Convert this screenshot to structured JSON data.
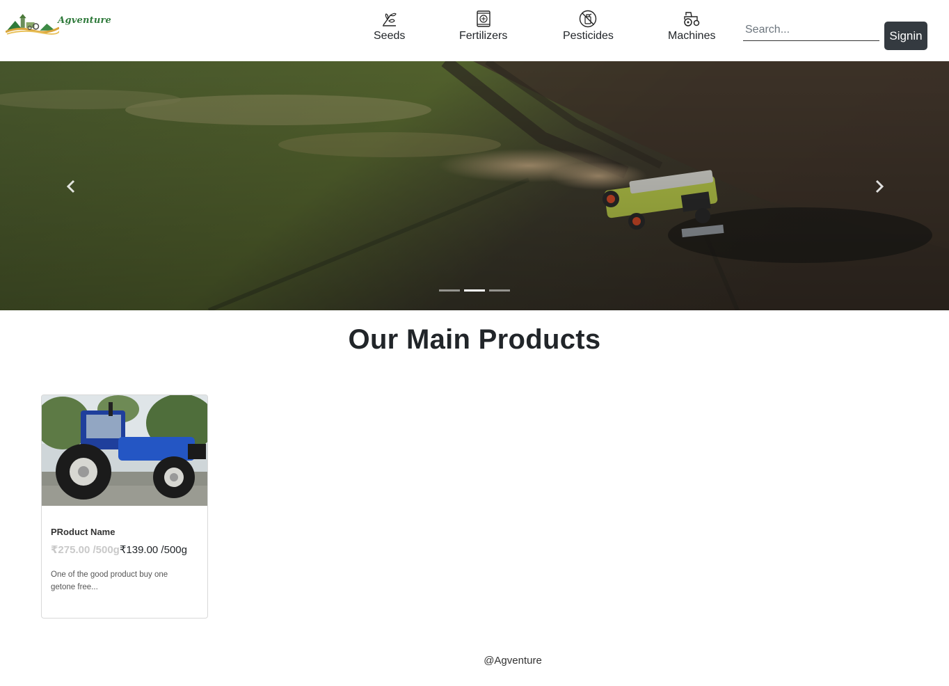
{
  "header": {
    "logo_text": "Agventure",
    "nav": [
      {
        "label": "Seeds",
        "icon": "seeds-icon"
      },
      {
        "label": "Fertilizers",
        "icon": "fertilizer-bag-icon"
      },
      {
        "label": "Pesticides",
        "icon": "pesticide-icon"
      },
      {
        "label": "Machines",
        "icon": "tractor-icon"
      }
    ],
    "search_placeholder": "Search...",
    "signin_label": "Signin"
  },
  "carousel": {
    "slides": 3,
    "active_index": 1,
    "prev_icon": "chevron-left-icon",
    "next_icon": "chevron-right-icon"
  },
  "products": {
    "title": "Our Main Products",
    "items": [
      {
        "name": "PRoduct Name",
        "old_price": "₹275.00 /500g",
        "new_price": "₹139.00 /500g",
        "description": "One of the good product buy one getone free..."
      }
    ]
  },
  "footer": {
    "text": "@Agventure"
  },
  "colors": {
    "signin_bg": "#343a40",
    "logo_green": "#2f7a3b",
    "old_price": "#c9c9c9"
  }
}
